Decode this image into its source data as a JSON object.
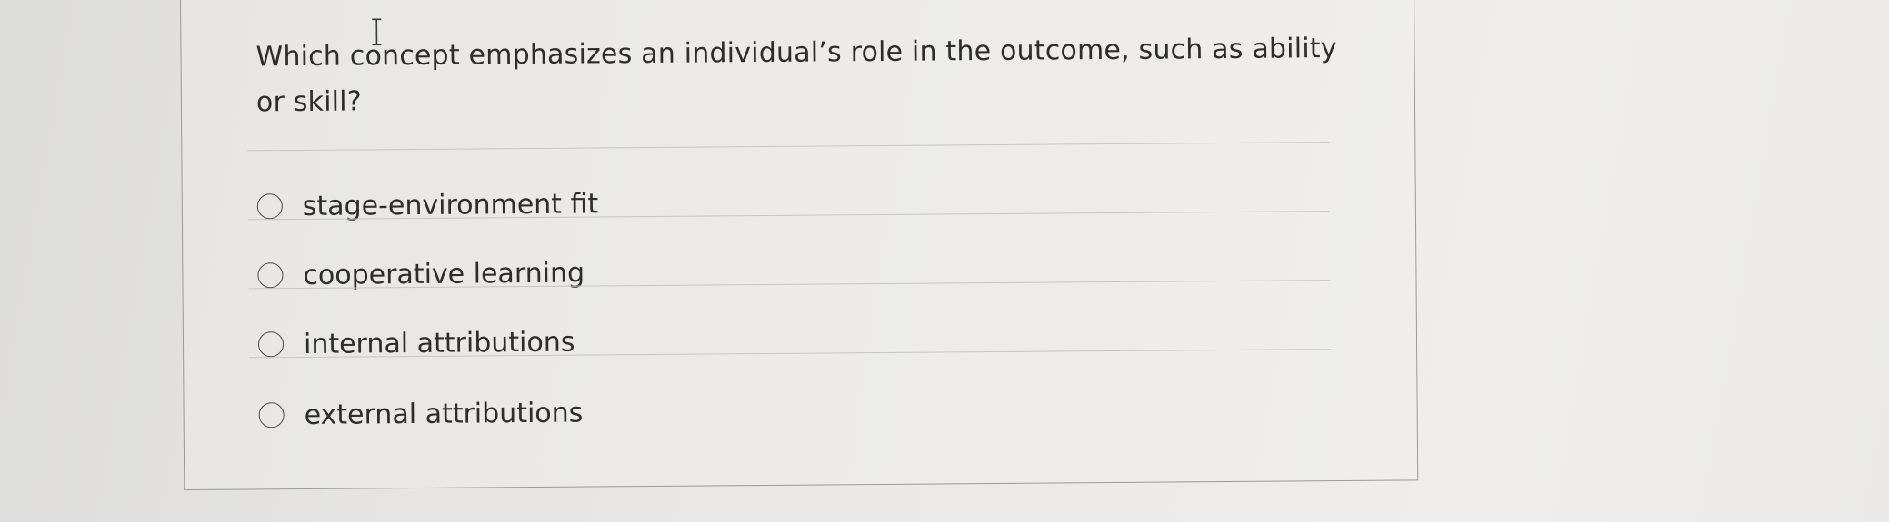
{
  "question": {
    "text": "Which concept emphasizes an individual’s role in the outcome, such as ability or skill?"
  },
  "options": [
    {
      "label": "stage-environment fit",
      "selected": false
    },
    {
      "label": "cooperative learning",
      "selected": false
    },
    {
      "label": "internal attributions",
      "selected": false
    },
    {
      "label": "external attributions",
      "selected": false
    }
  ],
  "colors": {
    "text": "#2d2d2d",
    "border": "#9a9a98",
    "divider": "#c6c6c4"
  }
}
